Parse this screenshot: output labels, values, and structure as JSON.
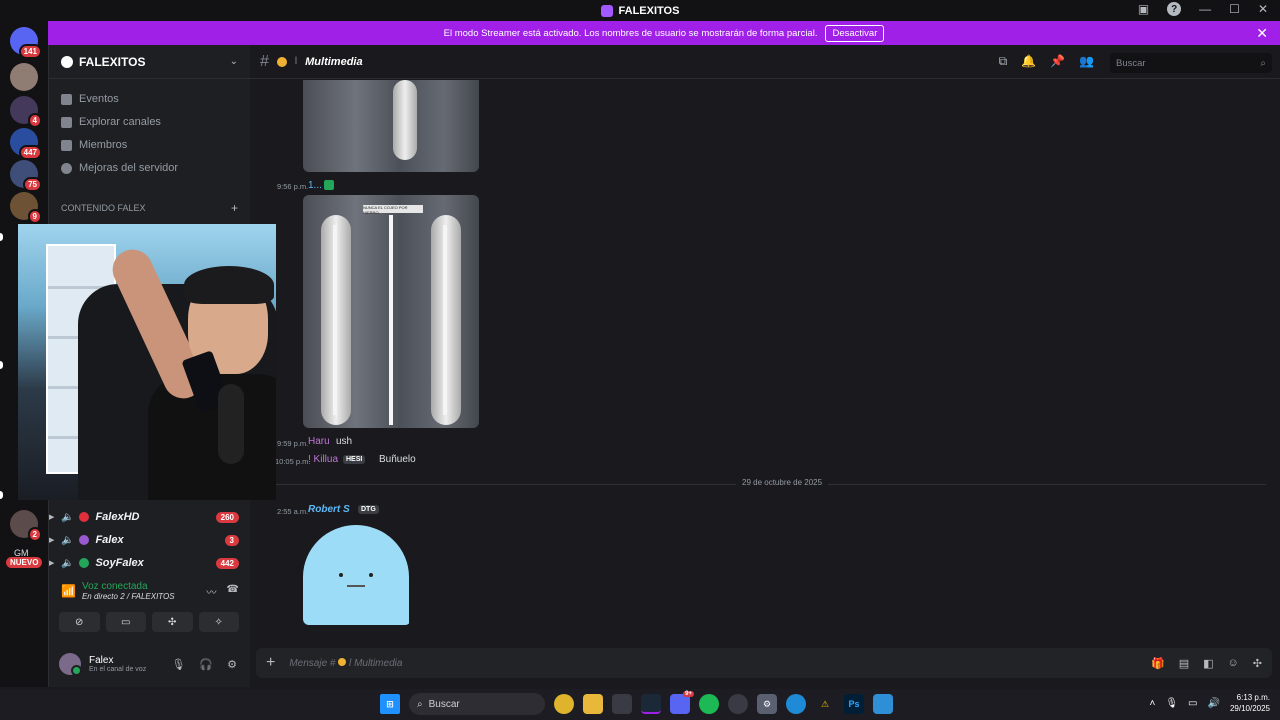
{
  "window": {
    "title": "FALEXITOS"
  },
  "banner": {
    "text": "El modo Streamer está activado. Los nombres de usuario se mostrarán de forma parcial.",
    "button": "Desactivar"
  },
  "server": {
    "name": "FALEXITOS",
    "nav": [
      "Eventos",
      "Explorar canales",
      "Miembros",
      "Mejoras del servidor"
    ],
    "category": "CONTENIDO FALEX",
    "voice_channels": [
      {
        "name": "FalexHD",
        "count": "260",
        "color": "#e0303b"
      },
      {
        "name": "Falex",
        "count": "3",
        "color": "#9b59d0"
      },
      {
        "name": "SoyFalex",
        "count": "442",
        "color": "#23a55a"
      }
    ]
  },
  "rail": {
    "home_badge": "141",
    "badges": [
      "4",
      "447",
      "75",
      "9",
      "2"
    ],
    "new_label": "NUEVO",
    "gm_label": "GM"
  },
  "voice": {
    "status": "Voz conectada",
    "channel": "En directo 2 / FALEXITOS"
  },
  "user": {
    "name": "Falex",
    "status": "En el canal de voz"
  },
  "channel": {
    "name": "Multimedia",
    "separator": "l"
  },
  "search": {
    "placeholder": "Buscar"
  },
  "messages": {
    "t1": "9:56 p.m.",
    "a1": "1...",
    "xray_caption": "NUNCA EL COJEO POR HIERRO",
    "t2": "9:59 p.m.",
    "a2": "Haru",
    "m2": "ush",
    "t3": "10:05 p.m.",
    "a3": "! Killua",
    "tag3": "HESI",
    "m3": "Buñuelo",
    "date": "29 de octubre de 2025",
    "t4": "2:55 a.m.",
    "a4": "Robert S",
    "tag4": "DTG"
  },
  "composer": {
    "placeholder_prefix": "Mensaje #",
    "channel": "Multimedia"
  },
  "taskbar": {
    "search": "Buscar",
    "time": "6:13 p.m.",
    "date": "29/10/2025",
    "discord_badge": "9+"
  },
  "colors": {
    "accent": "#a020e8",
    "online": "#23a55a",
    "danger": "#d93a3f"
  }
}
